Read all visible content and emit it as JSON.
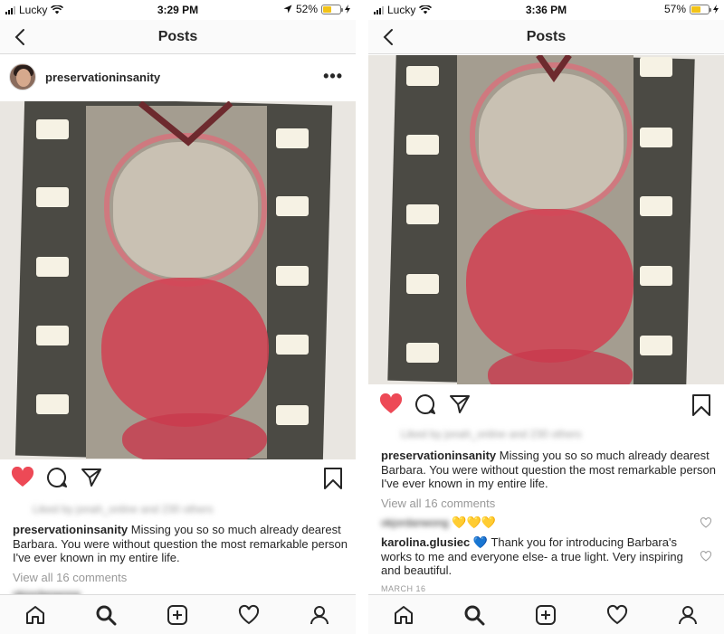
{
  "left": {
    "status": {
      "carrier": "Lucky",
      "time": "3:29 PM",
      "battery": "52%",
      "battery_level": 0.52
    },
    "nav": {
      "title": "Posts"
    },
    "post": {
      "username": "preservationinsanity",
      "more": "•••"
    },
    "likes_blurred": "Liked by jonah_online and 230 others",
    "caption": {
      "user": "preservationinsanity",
      "text": " Missing you so so much already dearest Barbara.  You were without question the most remarkable person I've ever known in my entire life."
    },
    "view_all": "View all 16 comments",
    "partial_comment": "okjordanwong"
  },
  "right": {
    "status": {
      "carrier": "Lucky",
      "time": "3:36 PM",
      "battery": "57%",
      "battery_level": 0.57
    },
    "nav": {
      "title": "Posts"
    },
    "likes_blurred": "Liked by jonah_online and 230 others",
    "caption": {
      "user": "preservationinsanity",
      "text": " Missing you so so much already dearest Barbara.  You were without question the most remarkable person I've ever known in my entire life."
    },
    "view_all": "View all 16 comments",
    "comments": [
      {
        "user": "okjordanwong",
        "text": "💛💛💛",
        "blurred": true
      },
      {
        "user": "karolina.glusiec",
        "text": " 💙 Thank you for introducing Barbara's works to me and everyone else- a true light. Very inspiring and beautiful.",
        "blurred": false
      }
    ],
    "date": "MARCH 16"
  },
  "colors": {
    "like_red": "#ed4956",
    "muted": "#999999",
    "border": "#dbdbdb",
    "battery": "#f2c318"
  },
  "icons": [
    "back-chevron-icon",
    "more-icon",
    "heart-icon",
    "comment-icon",
    "share-icon",
    "bookmark-icon",
    "home-icon",
    "search-icon",
    "add-icon",
    "activity-icon",
    "profile-icon"
  ]
}
